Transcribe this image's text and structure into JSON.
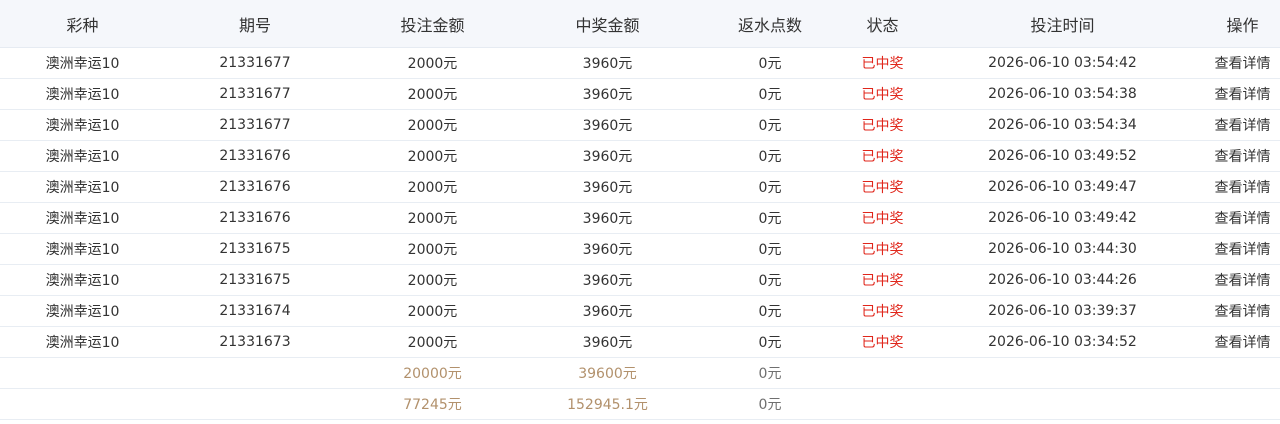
{
  "headers": {
    "lottery": "彩种",
    "period": "期号",
    "bet_amount": "投注金额",
    "win_amount": "中奖金额",
    "rebate": "返水点数",
    "status": "状态",
    "bet_time": "投注时间",
    "action": "操作"
  },
  "rows": [
    {
      "lottery": "澳洲幸运10",
      "period": "21331677",
      "bet": "2000元",
      "win": "3960元",
      "rebate": "0元",
      "status": "已中奖",
      "time": "2026-06-10 03:54:42",
      "action": "查看详情"
    },
    {
      "lottery": "澳洲幸运10",
      "period": "21331677",
      "bet": "2000元",
      "win": "3960元",
      "rebate": "0元",
      "status": "已中奖",
      "time": "2026-06-10 03:54:38",
      "action": "查看详情"
    },
    {
      "lottery": "澳洲幸运10",
      "period": "21331677",
      "bet": "2000元",
      "win": "3960元",
      "rebate": "0元",
      "status": "已中奖",
      "time": "2026-06-10 03:54:34",
      "action": "查看详情"
    },
    {
      "lottery": "澳洲幸运10",
      "period": "21331676",
      "bet": "2000元",
      "win": "3960元",
      "rebate": "0元",
      "status": "已中奖",
      "time": "2026-06-10 03:49:52",
      "action": "查看详情"
    },
    {
      "lottery": "澳洲幸运10",
      "period": "21331676",
      "bet": "2000元",
      "win": "3960元",
      "rebate": "0元",
      "status": "已中奖",
      "time": "2026-06-10 03:49:47",
      "action": "查看详情"
    },
    {
      "lottery": "澳洲幸运10",
      "period": "21331676",
      "bet": "2000元",
      "win": "3960元",
      "rebate": "0元",
      "status": "已中奖",
      "time": "2026-06-10 03:49:42",
      "action": "查看详情"
    },
    {
      "lottery": "澳洲幸运10",
      "period": "21331675",
      "bet": "2000元",
      "win": "3960元",
      "rebate": "0元",
      "status": "已中奖",
      "time": "2026-06-10 03:44:30",
      "action": "查看详情"
    },
    {
      "lottery": "澳洲幸运10",
      "period": "21331675",
      "bet": "2000元",
      "win": "3960元",
      "rebate": "0元",
      "status": "已中奖",
      "time": "2026-06-10 03:44:26",
      "action": "查看详情"
    },
    {
      "lottery": "澳洲幸运10",
      "period": "21331674",
      "bet": "2000元",
      "win": "3960元",
      "rebate": "0元",
      "status": "已中奖",
      "time": "2026-06-10 03:39:37",
      "action": "查看详情"
    },
    {
      "lottery": "澳洲幸运10",
      "period": "21331673",
      "bet": "2000元",
      "win": "3960元",
      "rebate": "0元",
      "status": "已中奖",
      "time": "2026-06-10 03:34:52",
      "action": "查看详情"
    }
  ],
  "summaries": [
    {
      "bet": "20000元",
      "win": "39600元",
      "rebate": "0元"
    },
    {
      "bet": "77245元",
      "win": "152945.1元",
      "rebate": "0元"
    }
  ],
  "colors": {
    "header_bg": "#f5f7fb",
    "won_status": "#e0261b",
    "summary_amount": "#b2916c"
  }
}
